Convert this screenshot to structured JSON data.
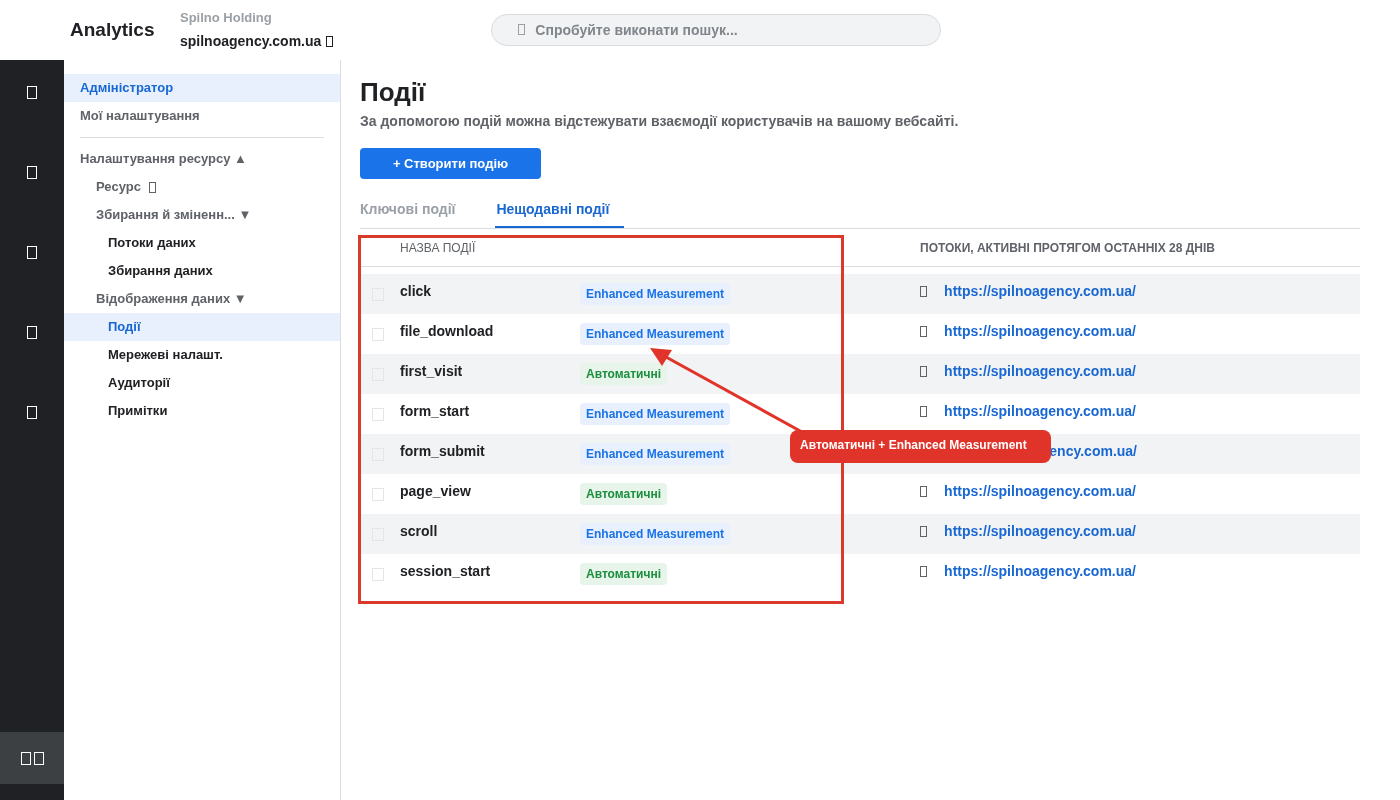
{
  "header": {
    "product": "Analytics",
    "account": "Spilno Holding",
    "property": "spilnoagency.com.ua",
    "search": {
      "placeholder": "Спробуйте виконати пошук..."
    }
  },
  "rail": {
    "items": [
      {
        "selected": false
      },
      {
        "selected": false
      },
      {
        "selected": false
      },
      {
        "selected": false
      },
      {
        "selected": false
      }
    ],
    "bottom": {
      "selected": true
    }
  },
  "sidebar": {
    "items": [
      {
        "label": "Адміністратор",
        "selected": true,
        "kind": "top"
      },
      {
        "label": "Мої налаштування",
        "selected": false,
        "kind": "top"
      },
      {
        "label": "Налаштування ресурсу ▲",
        "selected": false,
        "kind": "section",
        "children": [
          {
            "label": "Ресурс",
            "selected": false,
            "kind": "group",
            "icon": true
          },
          {
            "label": "Збирання й зміненн... ▼",
            "selected": false,
            "kind": "group",
            "children": [
              {
                "label": "Потоки даних",
                "selected": false,
                "kind": "leaf"
              },
              {
                "label": "Збирання даних",
                "selected": false,
                "kind": "leaf"
              }
            ]
          },
          {
            "label": "Відображення даних ▼",
            "selected": false,
            "kind": "group",
            "children": [
              {
                "label": "Події",
                "selected": true,
                "kind": "leaf"
              },
              {
                "label": "Мережеві налашт.",
                "selected": false,
                "kind": "leaf"
              },
              {
                "label": "Аудиторії",
                "selected": false,
                "kind": "leaf"
              },
              {
                "label": "Примітки",
                "selected": false,
                "kind": "leaf"
              }
            ]
          }
        ]
      }
    ]
  },
  "page": {
    "title": "Події",
    "subtitle": "За допомогою подій можна відстежувати взаємодії користувачів на вашому вебсайті.",
    "create_button": "+ Створити подію",
    "tabs": [
      {
        "label": "Ключові події",
        "selected": false
      },
      {
        "label": "Нещодавні події",
        "selected": true
      }
    ],
    "table": {
      "columns": [
        "НАЗВА ПОДІЇ",
        "ПОТОКИ, АКТИВНІ ПРОТЯГОМ ОСТАННІХ 28 ДНІВ"
      ],
      "rows": [
        {
          "name": "click",
          "tag": "Enhanced Measurement",
          "kind": "enhanced",
          "stream": "https://spilnoagency.com.ua/",
          "checked": false,
          "covered": false
        },
        {
          "name": "file_download",
          "tag": "Enhanced Measurement",
          "kind": "enhanced",
          "stream": "https://spilnoagency.com.ua/",
          "checked": false,
          "covered": false
        },
        {
          "name": "first_visit",
          "tag": "Автоматичні",
          "kind": "auto",
          "stream": "https://spilnoagency.com.ua/",
          "checked": false,
          "covered": false
        },
        {
          "name": "form_start",
          "tag": "Enhanced Measurement",
          "kind": "enhanced",
          "stream": "https://spilnoagency.com.ua/",
          "checked": false,
          "covered": false
        },
        {
          "name": "form_submit",
          "tag": "Enhanced Measurement",
          "kind": "enhanced",
          "stream": "ency.com.ua/",
          "checked": false,
          "covered": true
        },
        {
          "name": "page_view",
          "tag": "Автоматичні",
          "kind": "auto",
          "stream": "https://spilnoagency.com.ua/",
          "checked": false,
          "covered": false
        },
        {
          "name": "scroll",
          "tag": "Enhanced Measurement",
          "kind": "enhanced",
          "stream": "https://spilnoagency.com.ua/",
          "checked": false,
          "covered": false
        },
        {
          "name": "session_start",
          "tag": "Автоматичні",
          "kind": "auto",
          "stream": "https://spilnoagency.com.ua/",
          "checked": false,
          "covered": false
        }
      ]
    }
  },
  "annotation": {
    "callout": "Автоматичні + Enhanced Measurement"
  }
}
